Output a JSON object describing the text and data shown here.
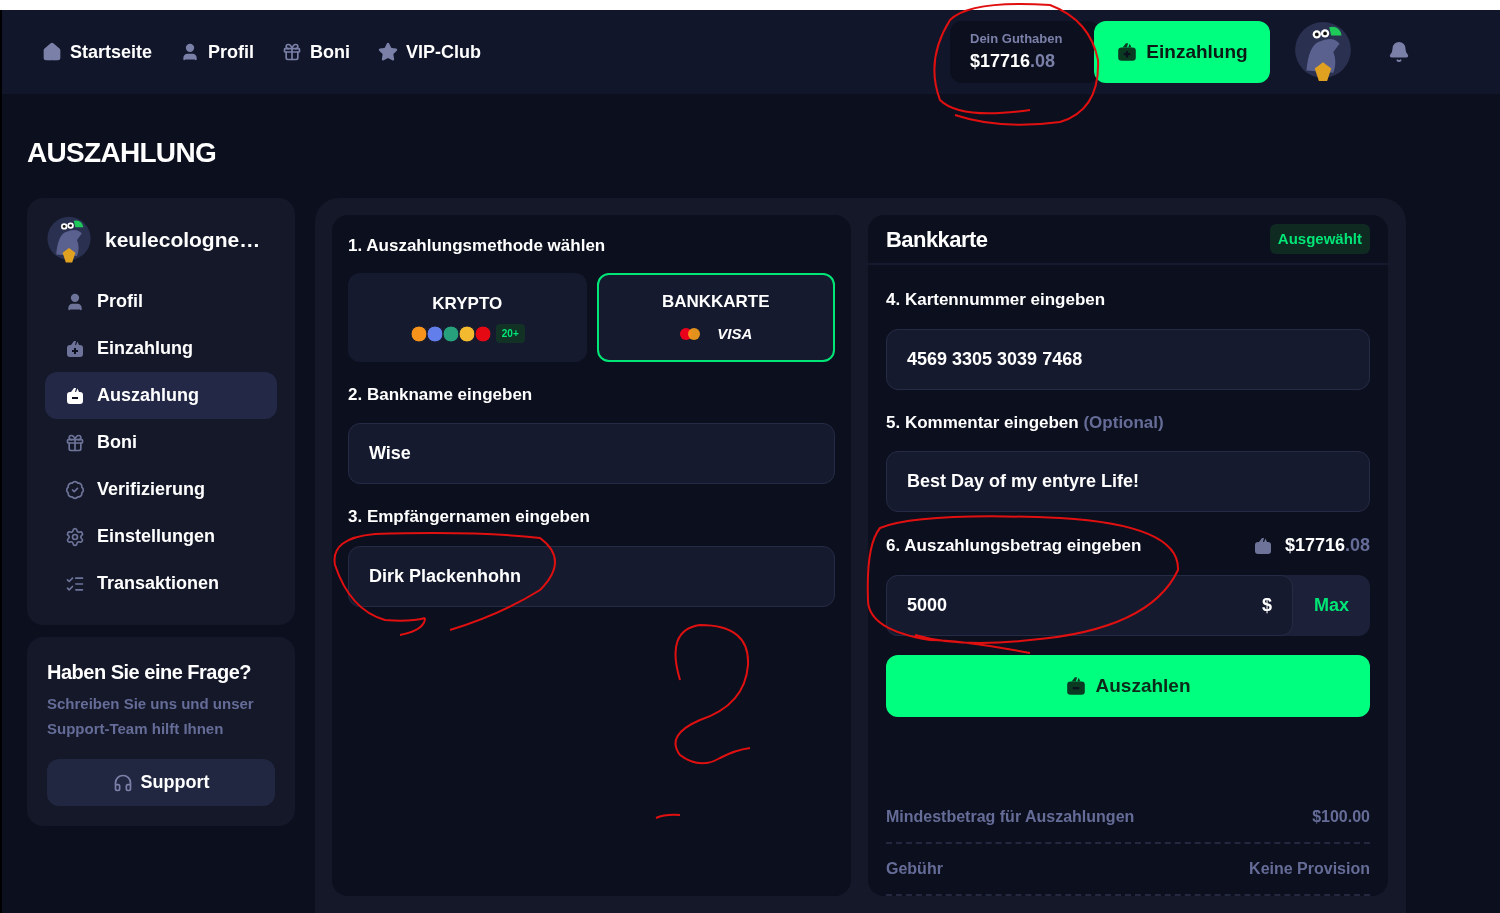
{
  "nav": {
    "items": [
      {
        "kind": "home",
        "label": "Startseite"
      },
      {
        "kind": "user",
        "label": "Profil"
      },
      {
        "kind": "gift",
        "label": "Boni"
      },
      {
        "kind": "star",
        "label": "VIP-Club"
      }
    ]
  },
  "balance": {
    "label": "Dein Guthaben",
    "amount": "$17716",
    "cents": ".08"
  },
  "deposit_button": "Einzahlung",
  "page_title": "AUSZAHLUNG",
  "profile": {
    "username": "keulecologne…"
  },
  "sidebar": {
    "items": [
      {
        "kind": "user",
        "label": "Profil",
        "selected": false
      },
      {
        "kind": "deposit",
        "label": "Einzahlung",
        "selected": false
      },
      {
        "kind": "withdraw",
        "label": "Auszahlung",
        "selected": true
      },
      {
        "kind": "gift",
        "label": "Boni",
        "selected": false
      },
      {
        "kind": "verify",
        "label": "Verifizierung",
        "selected": false
      },
      {
        "kind": "settings",
        "label": "Einstellungen",
        "selected": false
      },
      {
        "kind": "list",
        "label": "Transaktionen",
        "selected": false
      }
    ]
  },
  "help": {
    "title": "Haben Sie eine Frage?",
    "text": "Schreiben Sie uns und unser Support-Team hilft Ihnen",
    "button": "Support"
  },
  "method": {
    "heading": "1. Auszahlungsmethode wählen",
    "options": [
      {
        "kind": "crypto",
        "label": "KRYPTO",
        "badge": "20+",
        "selected": false
      },
      {
        "kind": "card",
        "label": "BANKKARTE",
        "brand": "VISA",
        "selected": true
      }
    ]
  },
  "bank_name": {
    "label": "2. Bankname eingeben",
    "value": "Wise"
  },
  "recipient": {
    "label": "3. Empfängernamen eingeben",
    "value": "Dirk Plackenhohn"
  },
  "card_panel": {
    "title": "Bankkarte",
    "badge": "Ausgewählt"
  },
  "card_number": {
    "label": "4. Kartennummer eingeben",
    "value": "4569 3305 3039 7468"
  },
  "comment": {
    "label": "5. Kommentar eingeben",
    "optional": "(Optional)",
    "value": "Best Day of my entyre Life!"
  },
  "amount": {
    "label": "6. Auszahlungsbetrag eingeben",
    "balance": "$17716",
    "cents": ".08",
    "value": "5000",
    "currency": "$",
    "max": "Max"
  },
  "submit_button": "Auszahlen",
  "info": [
    {
      "label": "Mindestbetrag für Auszahlungen",
      "value": "$100.00"
    },
    {
      "label": "Gebühr",
      "value": "Keine Provision"
    }
  ]
}
